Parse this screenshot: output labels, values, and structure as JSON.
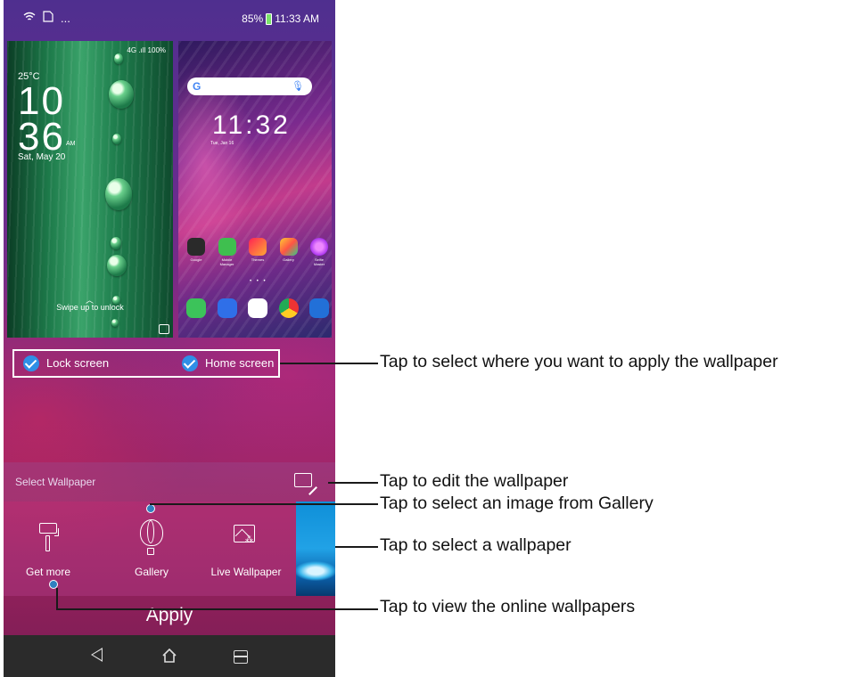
{
  "status_bar": {
    "battery": "85%",
    "time": "11:33 AM",
    "ellipsis": "..."
  },
  "lock_preview": {
    "signal": "4G .ıll 100%",
    "temperature": "25°C",
    "hour": "10",
    "minute": "36",
    "ampm": "AM",
    "date": "Sat, May 20",
    "swipe_text": "Swipe up to unlock"
  },
  "home_preview": {
    "search_g": "G",
    "clock": "11:32",
    "date_line": "Tue, Jan 16",
    "apps": [
      "Google",
      "Mobile Manager",
      "Themes",
      "Gallery",
      "Selfie Master"
    ]
  },
  "options": {
    "lock_screen": "Lock screen",
    "home_screen": "Home screen"
  },
  "select_wallpaper": "Select Wallpaper",
  "picker": {
    "get_more": "Get more",
    "gallery": "Gallery",
    "live_wallpaper": "Live Wallpaper"
  },
  "apply": "Apply",
  "callouts": {
    "apply_location": "Tap to select where you want to apply the wallpaper",
    "edit": "Tap to edit the wallpaper",
    "gallery": "Tap to select an image from Gallery",
    "select": "Tap to select a wallpaper",
    "online": "Tap to view the online wallpapers"
  },
  "colors": {
    "check_blue": "#2f8fe6",
    "nav_bar": "#2b2b2b"
  }
}
